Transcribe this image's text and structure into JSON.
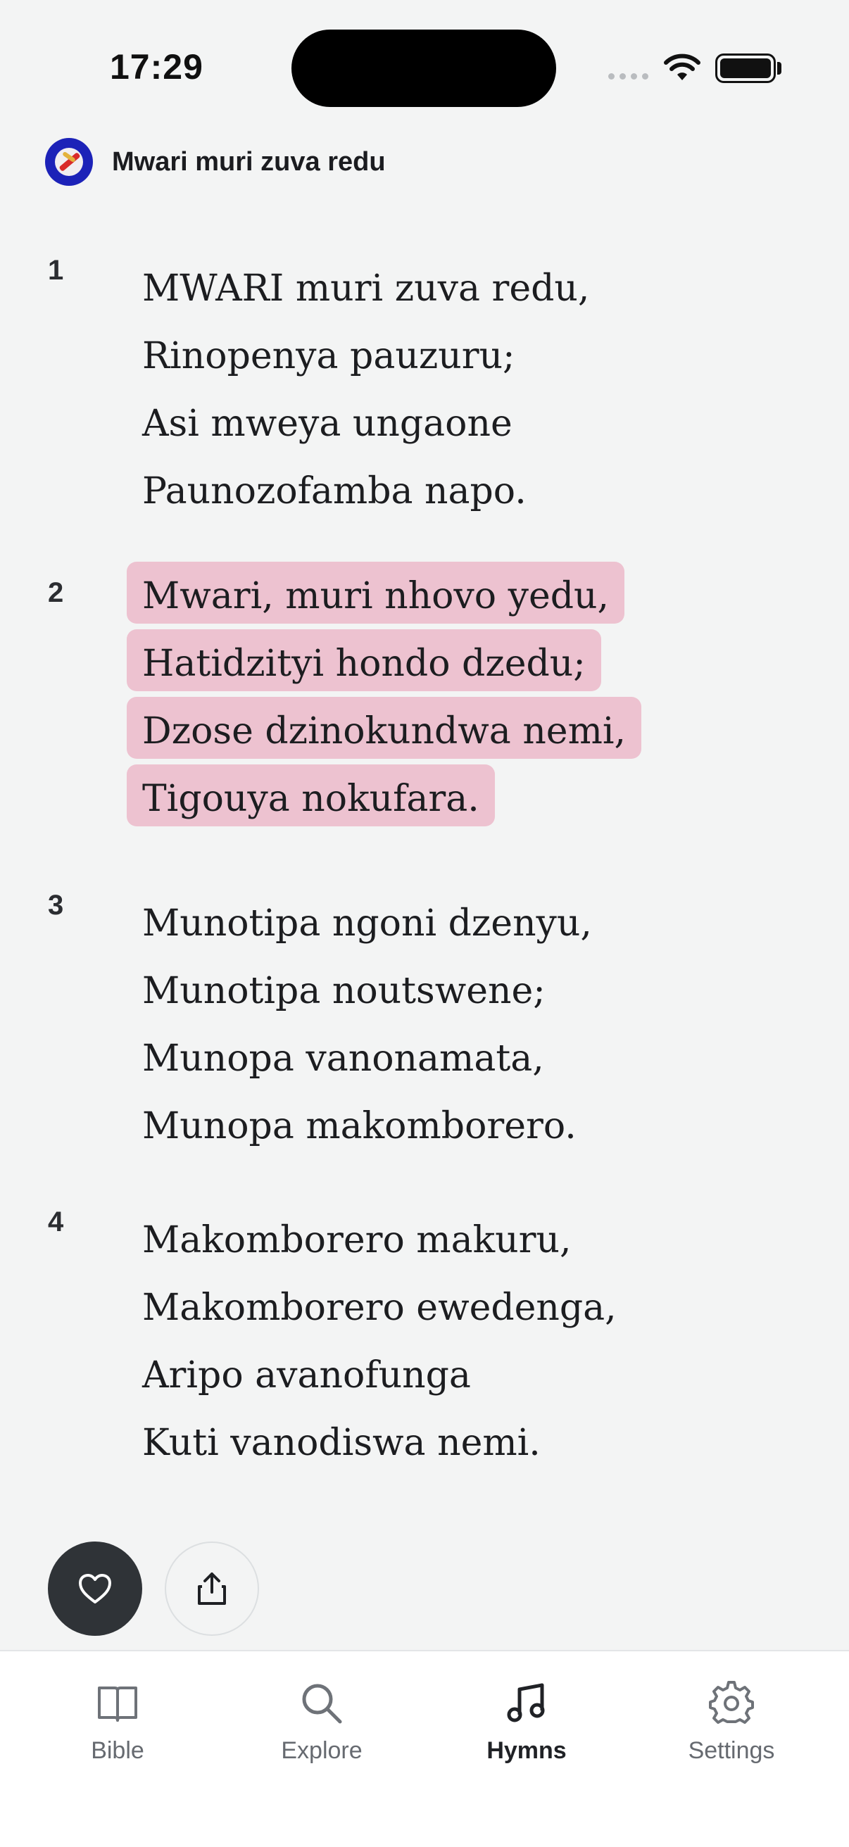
{
  "status_bar": {
    "time": "17:29"
  },
  "header": {
    "title": "Mwari muri zuva redu"
  },
  "hymn": {
    "stanzas": [
      {
        "number": "1",
        "highlighted": false,
        "lines": [
          "MWARI muri zuva redu,",
          "Rinopenya pauzuru;",
          "Asi mweya ungaone",
          "Paunozofamba napo."
        ]
      },
      {
        "number": "2",
        "highlighted": true,
        "lines": [
          "Mwari, muri nhovo yedu,",
          "Hatidzityi hondo dzedu;",
          "Dzose dzinokundwa nemi,",
          "Tigouya nokufara."
        ]
      },
      {
        "number": "3",
        "highlighted": false,
        "lines": [
          "Munotipa ngoni dzenyu,",
          "Munotipa noutswene;",
          "Munopa vanonamata,",
          "Munopa makomborero."
        ]
      },
      {
        "number": "4",
        "highlighted": false,
        "lines": [
          "Makomborero makuru,",
          "Makomborero ewedenga,",
          "Aripo avanofunga",
          "Kuti vanodiswa nemi."
        ]
      }
    ]
  },
  "actions": {
    "favorite_icon": "heart-icon",
    "share_icon": "share-icon"
  },
  "nav": {
    "items": [
      {
        "label": "Bible",
        "icon": "book-icon",
        "active": false
      },
      {
        "label": "Explore",
        "icon": "search-icon",
        "active": false
      },
      {
        "label": "Hymns",
        "icon": "music-note-icon",
        "active": true
      },
      {
        "label": "Settings",
        "icon": "gear-icon",
        "active": false
      }
    ]
  },
  "colors": {
    "highlight": "#edc2d0",
    "background": "#f3f4f4",
    "fab": "#2f3337"
  }
}
